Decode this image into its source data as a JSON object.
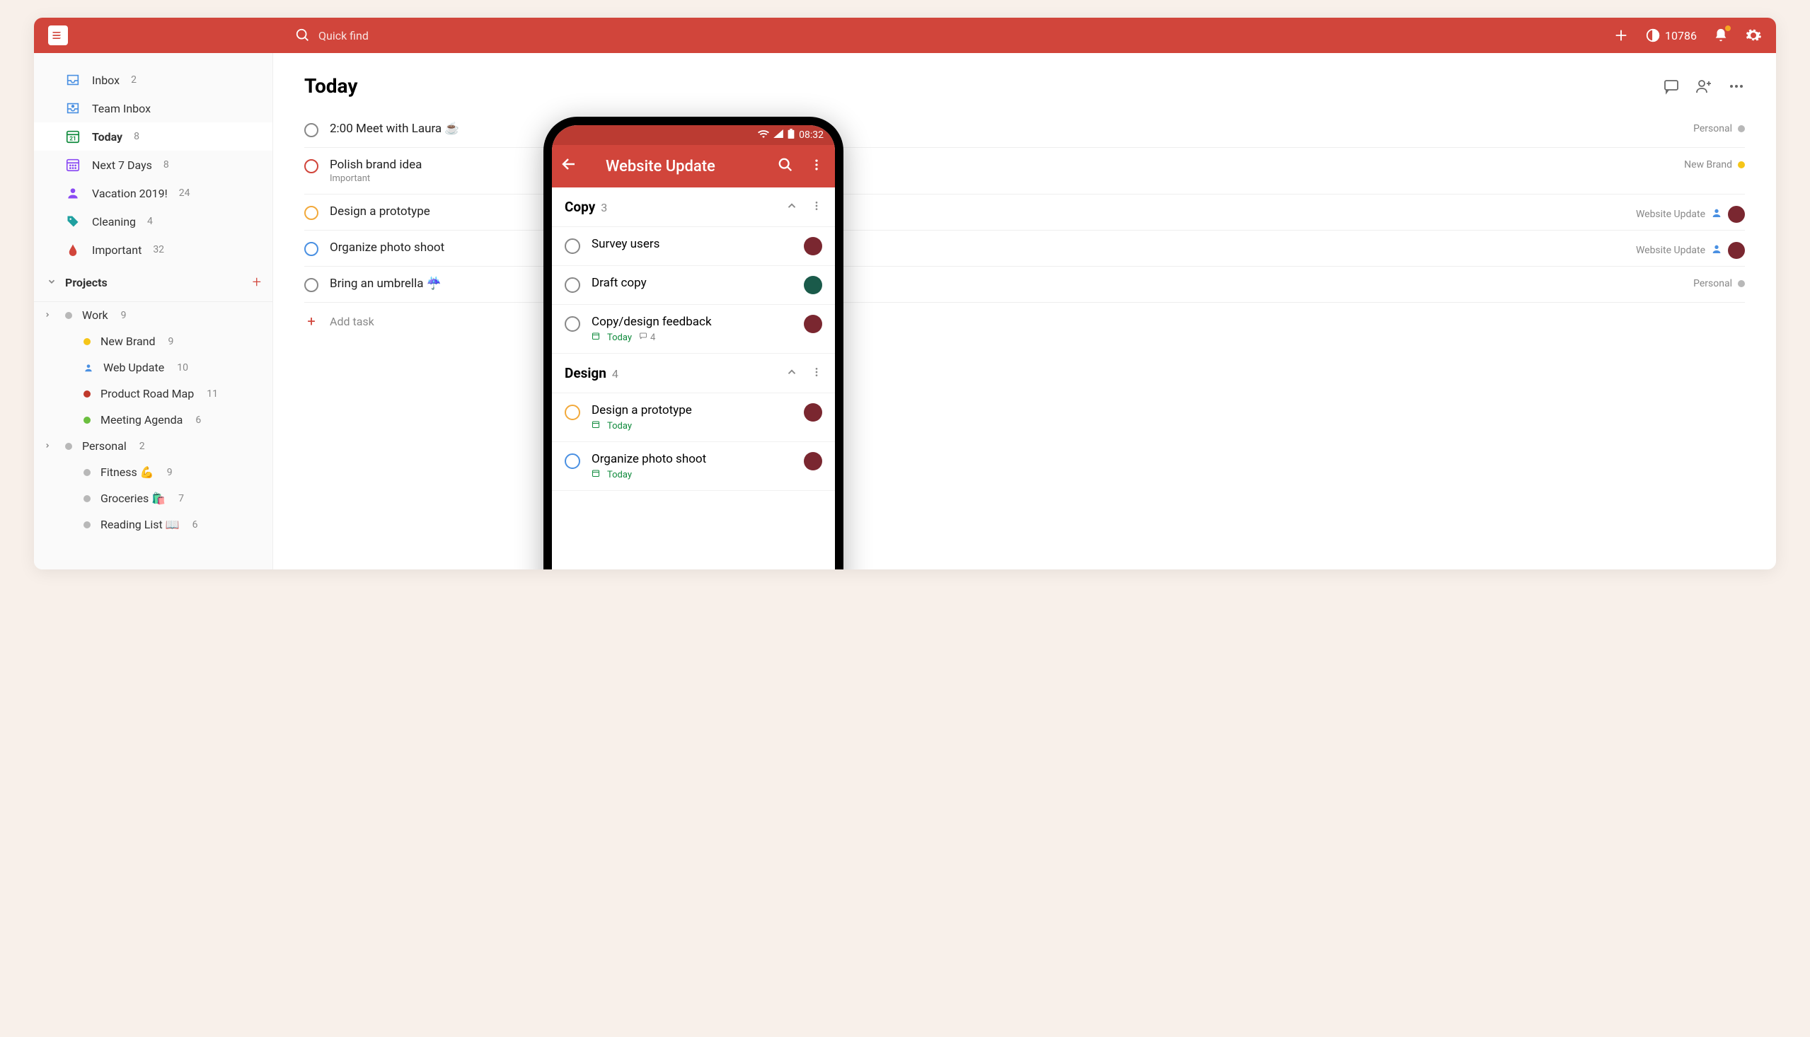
{
  "topbar": {
    "search_placeholder": "Quick find",
    "karma": "10786"
  },
  "sidebar": {
    "filters": [
      {
        "label": "Inbox",
        "count": "2",
        "icon": "inbox",
        "color": "#4a90e2"
      },
      {
        "label": "Team Inbox",
        "count": "",
        "icon": "team-inbox",
        "color": "#4a90e2"
      },
      {
        "label": "Today",
        "count": "8",
        "icon": "today",
        "color": "#0f8a3c",
        "active": true
      },
      {
        "label": "Next 7 Days",
        "count": "8",
        "icon": "calendar",
        "color": "#8a4af3"
      },
      {
        "label": "Vacation 2019!",
        "count": "24",
        "icon": "person",
        "color": "#8a4af3"
      },
      {
        "label": "Cleaning",
        "count": "4",
        "icon": "tag",
        "color": "#1fa0a0"
      },
      {
        "label": "Important",
        "count": "32",
        "icon": "drop",
        "color": "#d1453b"
      }
    ],
    "projects_header": "Projects",
    "projects": [
      {
        "label": "Work",
        "count": "9",
        "color": "#b8b8b8",
        "expandable": true
      },
      {
        "label": "New Brand",
        "count": "9",
        "color": "#f5c518",
        "sub": true
      },
      {
        "label": "Web Update",
        "count": "10",
        "color": "#4a90e2",
        "sub": true,
        "icon": "person"
      },
      {
        "label": "Product Road Map",
        "count": "11",
        "color": "#c0392b",
        "sub": true
      },
      {
        "label": "Meeting Agenda",
        "count": "6",
        "color": "#6bbf3f",
        "sub": true
      },
      {
        "label": "Personal",
        "count": "2",
        "color": "#b8b8b8",
        "expandable": true
      },
      {
        "label": "Fitness 💪",
        "count": "9",
        "color": "#b8b8b8",
        "sub": true
      },
      {
        "label": "Groceries 🛍️",
        "count": "7",
        "color": "#b8b8b8",
        "sub": true
      },
      {
        "label": "Reading List 📖",
        "count": "6",
        "color": "#b8b8b8",
        "sub": true
      }
    ]
  },
  "content": {
    "title": "Today",
    "tasks": [
      {
        "title": "2:00 Meet with Laura ☕",
        "check_color": "#888",
        "meta_label": "Personal",
        "meta_color": "#b8b8b8"
      },
      {
        "title": "Polish brand idea",
        "subtitle": "Important",
        "check_color": "#d1453b",
        "meta_label": "New Brand",
        "meta_color": "#f5c518"
      },
      {
        "title": "Design a prototype",
        "check_color": "#f2a93b",
        "meta_label": "Website Update",
        "meta_icon": "person",
        "avatar": true
      },
      {
        "title": "Organize photo shoot",
        "check_color": "#4a90e2",
        "meta_label": "Website Update",
        "meta_icon": "person",
        "avatar": true
      },
      {
        "title": "Bring an umbrella ☔",
        "check_color": "#888",
        "meta_label": "Personal",
        "meta_color": "#b8b8b8"
      }
    ],
    "add_task_label": "Add task"
  },
  "phone": {
    "time": "08:32",
    "header_title": "Website Update",
    "sections": [
      {
        "name": "Copy",
        "count": "3",
        "tasks": [
          {
            "title": "Survey users",
            "check_color": "#888",
            "avatar": "#7a2730"
          },
          {
            "title": "Draft copy",
            "check_color": "#888",
            "avatar": "#1a5a4a"
          },
          {
            "title": "Copy/design feedback",
            "check_color": "#888",
            "avatar": "#7a2730",
            "date": "Today",
            "comments": "4"
          }
        ]
      },
      {
        "name": "Design",
        "count": "4",
        "tasks": [
          {
            "title": "Design a prototype",
            "check_color": "#f2a93b",
            "avatar": "#7a2730",
            "date": "Today"
          },
          {
            "title": "Organize photo shoot",
            "check_color": "#4a90e2",
            "avatar": "#7a2730",
            "date": "Today"
          }
        ]
      }
    ]
  }
}
